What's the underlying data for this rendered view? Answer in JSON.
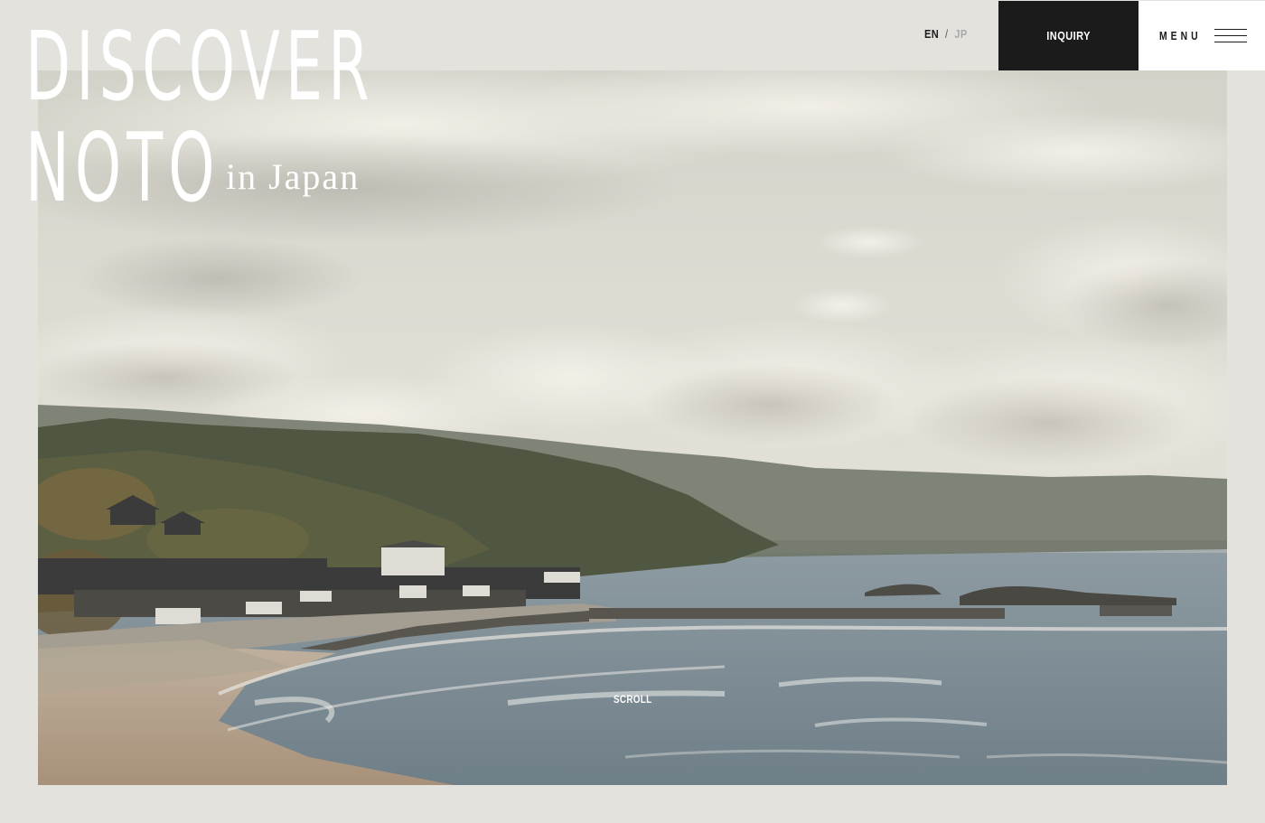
{
  "hero": {
    "title_line1": "DISCOVER",
    "title_line2": "NOTO",
    "subtitle": "in Japan",
    "image_icon": "coastal-landscape-photo"
  },
  "header": {
    "lang_en": "EN",
    "lang_separator": "/",
    "lang_jp": "JP",
    "inquiry_label": "INQUIRY",
    "menu_label": "MENU",
    "menu_icon": "hamburger-icon"
  },
  "scroll_label": "SCROLL",
  "colors": {
    "background": "#e4e2dd",
    "dark": "#1b1b1b",
    "white": "#ffffff",
    "inactive_lang": "#a9a9a9"
  }
}
